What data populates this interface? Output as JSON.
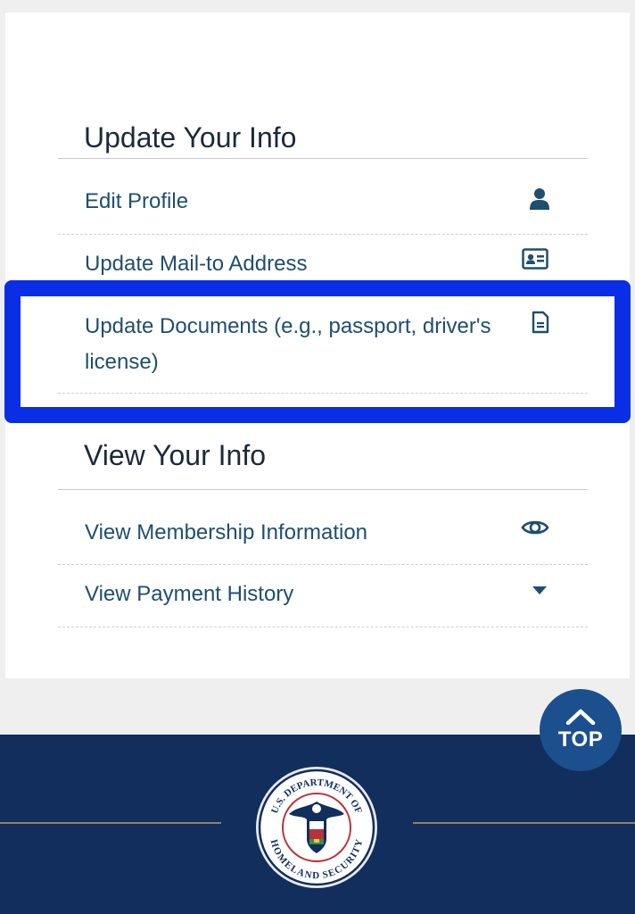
{
  "update_section": {
    "title": "Update Your Info",
    "items": [
      {
        "label": "Edit Profile",
        "icon": "user-icon"
      },
      {
        "label": "Update Mail-to Address",
        "icon": "id-card-icon"
      },
      {
        "label": "Update Documents (e.g., passport, driver's license)",
        "icon": "document-icon"
      }
    ]
  },
  "view_section": {
    "title": "View Your Info",
    "items": [
      {
        "label": "View Membership Information",
        "icon": "eye-icon"
      },
      {
        "label": "View Payment History",
        "icon": "caret-down-icon"
      }
    ]
  },
  "top_button": {
    "label": "TOP",
    "icon": "chevron-up-icon"
  },
  "footer": {
    "seal": {
      "text_top": "U.S. DEPARTMENT OF",
      "text_bottom": "HOMELAND SECURITY",
      "icon": "dhs-seal-icon"
    }
  },
  "colors": {
    "link": "#1f4e6e",
    "highlight": "#0a2ee6",
    "footer_bg": "#112e5c",
    "top_button_bg": "#1c4f8e"
  }
}
